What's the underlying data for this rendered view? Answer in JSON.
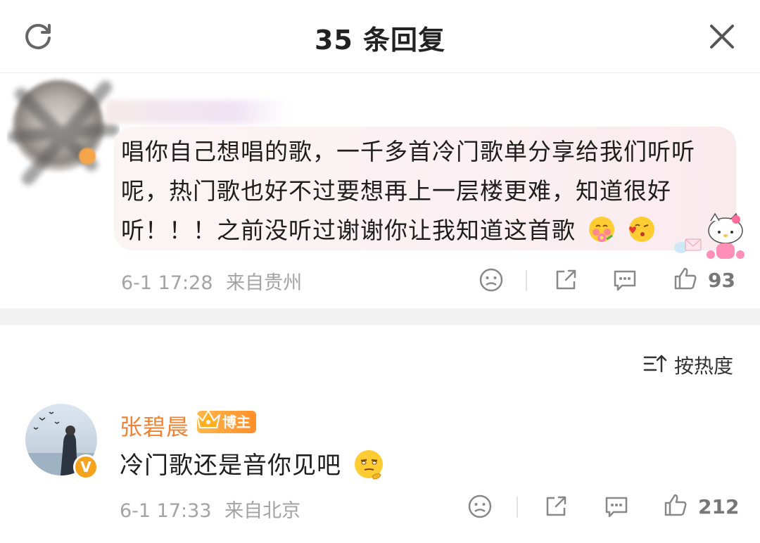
{
  "header": {
    "title": "35 条回复",
    "refresh_icon": "refresh-icon",
    "close_icon": "close-icon"
  },
  "root_comment": {
    "text_part1": "唱你自己想唱的歌，一千多首冷门歌单分享给我们听听呢，热门歌也好不过要想再上一层楼更难，知道很好听！！！之前没听过谢谢你让我知道这首歌",
    "emojis": [
      "blush-flower-emoji",
      "kiss-emoji"
    ],
    "sticker": "hello-kitty-sticker",
    "time": "6-1 17:28",
    "location": "来自贵州",
    "like_count": "93"
  },
  "sort": {
    "label": "按热度"
  },
  "reply": {
    "username": "张碧晨",
    "badge": "博主",
    "text": "冷门歌还是音你见吧",
    "emoji": "thinking-smirk-emoji",
    "time": "6-1 17:33",
    "location": "来自北京",
    "like_count": "212"
  },
  "colors": {
    "username": "#f08333",
    "badge": "#ff8f2a",
    "meta": "#a3a3a3",
    "bubble": "#fbf0f3"
  }
}
